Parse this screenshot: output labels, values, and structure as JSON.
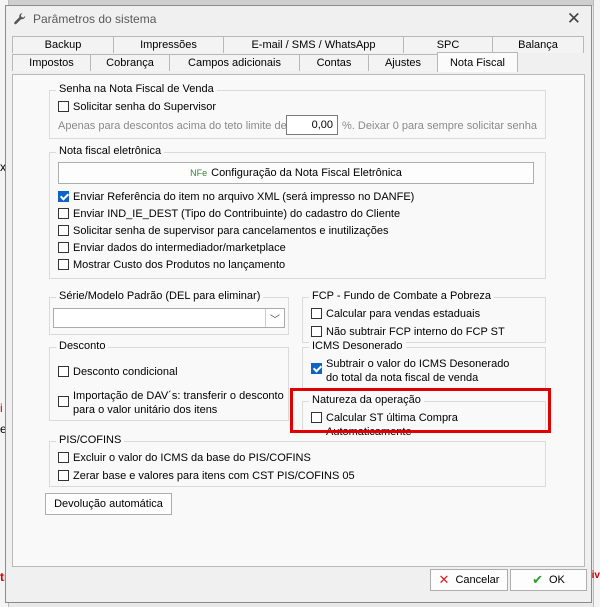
{
  "window": {
    "title": "Parâmetros do sistema",
    "close_glyph": "✕"
  },
  "tabs_row1": [
    "Backup",
    "Impressões",
    "E-mail / SMS / WhatsApp",
    "SPC",
    "Balança"
  ],
  "tabs_row2": [
    "Impostos",
    "Cobrança",
    "Campos adicionais",
    "Contas",
    "Ajustes",
    "Nota Fiscal"
  ],
  "active_tab": "Nota Fiscal",
  "senha": {
    "title": "Senha na Nota Fiscal de Venda",
    "checkbox": "Solicitar senha do Supervisor",
    "limit_prefix": "Apenas para descontos acima do teto limite de:",
    "limit_value": "0,00",
    "limit_suffix": "%. Deixar 0 para sempre solicitar senha"
  },
  "nfe": {
    "title": "Nota fiscal eletrônica",
    "config_button_tag": "NFe",
    "config_button": "Configuração da Nota Fiscal Eletrônica",
    "options": [
      {
        "label": "Enviar Referência do item no arquivo XML (será impresso no DANFE)",
        "checked": true
      },
      {
        "label": "Enviar IND_IE_DEST (Tipo do Contribuinte) do cadastro do Cliente",
        "checked": false
      },
      {
        "label": "Solicitar senha de supervisor para cancelamentos e inutilizações",
        "checked": false
      },
      {
        "label": "Enviar dados do intermediador/marketplace",
        "checked": false
      },
      {
        "label": "Mostrar Custo dos Produtos no lançamento",
        "checked": false
      }
    ]
  },
  "serie": {
    "title": "Série/Modelo Padrão (DEL para eliminar)",
    "value": ""
  },
  "fcp": {
    "title": "FCP - Fundo de Combate a Pobreza",
    "options": [
      {
        "label": "Calcular para vendas estaduais",
        "checked": false
      },
      {
        "label": "Não subtrair FCP interno do FCP ST",
        "checked": false
      }
    ]
  },
  "desconto": {
    "title": "Desconto",
    "options": [
      {
        "label": "Desconto condicional",
        "checked": false
      },
      {
        "label": "Importação de DAV´s: transferir o desconto",
        "label2": "para o valor unitário dos itens",
        "checked": false
      }
    ]
  },
  "icms": {
    "title": "ICMS Desonerado",
    "option": {
      "label": "Subtrair o valor do ICMS Desonerado",
      "label2": "do total da nota fiscal de venda",
      "checked": true
    }
  },
  "natureza": {
    "title": "Natureza da operação",
    "option": {
      "label": "Calcular ST última Compra Automaticamente",
      "checked": false
    }
  },
  "pis": {
    "title": "PIS/COFINS",
    "options": [
      {
        "label": "Excluir o valor do ICMS da base do PIS/COFINS",
        "checked": false
      },
      {
        "label": "Zerar base e valores para itens com CST PIS/COFINS 05",
        "checked": false
      }
    ]
  },
  "devolucao_button": "Devolução automática",
  "footer": {
    "cancel": "Cancelar",
    "ok": "OK"
  },
  "colors": {
    "accent": "#0d63c7",
    "highlight": "#e00000",
    "ok_check": "#2e9b2e",
    "cancel_x": "#d42020"
  },
  "background_fragments": [
    "xo",
    "i",
    "e",
    "tr",
    "tiv"
  ]
}
